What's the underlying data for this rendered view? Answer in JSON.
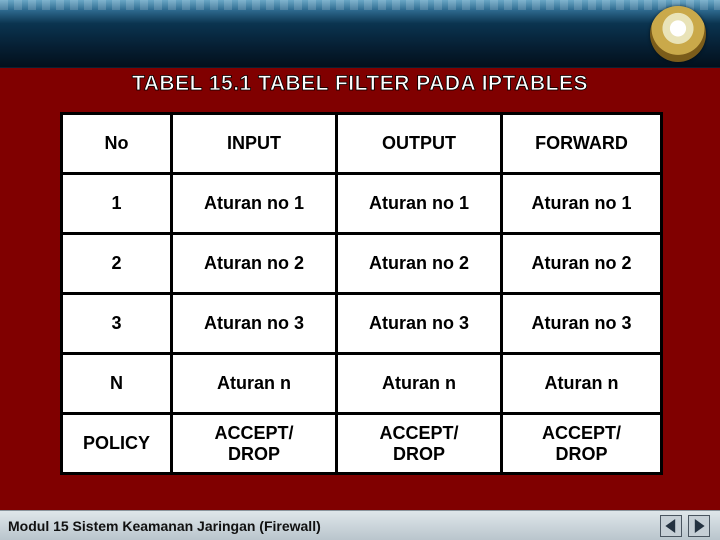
{
  "title": "TABEL  15.1 TABEL FILTER PADA IPTABLES",
  "footer": "Modul 15 Sistem Keamanan Jaringan (Firewall)",
  "table": {
    "headers": [
      "No",
      "INPUT",
      "OUTPUT",
      "FORWARD"
    ],
    "rows": [
      [
        "1",
        "Aturan no 1",
        "Aturan no 1",
        "Aturan no 1"
      ],
      [
        "2",
        "Aturan no 2",
        "Aturan no 2",
        "Aturan no 2"
      ],
      [
        "3",
        "Aturan no 3",
        "Aturan no 3",
        "Aturan no 3"
      ],
      [
        "N",
        "Aturan n",
        "Aturan n",
        "Aturan n"
      ],
      [
        "POLICY",
        "ACCEPT/\nDROP",
        "ACCEPT/\nDROP",
        "ACCEPT/\nDROP"
      ]
    ]
  },
  "nav": {
    "prev_name": "prev-button",
    "next_name": "next-button"
  }
}
